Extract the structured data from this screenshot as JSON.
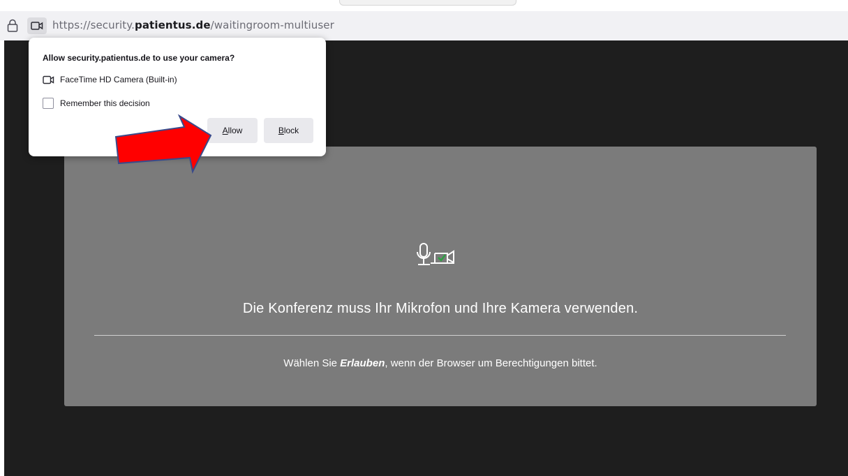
{
  "browser": {
    "url_prefix": "https://security.",
    "url_domain": "patientus.de",
    "url_path": "/waitingroom-multiuser"
  },
  "permission_popup": {
    "title": "Allow security.patientus.de to use your camera?",
    "device_label": "FaceTime HD Camera (Built-in)",
    "remember_label": "Remember this decision",
    "allow_key": "A",
    "allow_rest": "llow",
    "block_key": "B",
    "block_rest": "lock"
  },
  "panel": {
    "heading": "Die Konferenz muss Ihr Mikrofon und Ihre Kamera verwenden.",
    "hint_prefix": "Wählen Sie ",
    "hint_emphasis": "Erlauben",
    "hint_suffix": ", wenn der Browser um Berechtigungen bittet."
  },
  "icons": {
    "lock": "lock-icon",
    "camera_permission": "camera-icon",
    "mic_camera": "microphone-camera-icon",
    "annotation_arrow": "red-arrow"
  },
  "colors": {
    "page_background": "#1e1e1e",
    "panel_background": "#7b7b7b",
    "check_mark": "#2ea043",
    "arrow_fill": "#ff0000",
    "arrow_stroke": "#3a4a8a"
  }
}
